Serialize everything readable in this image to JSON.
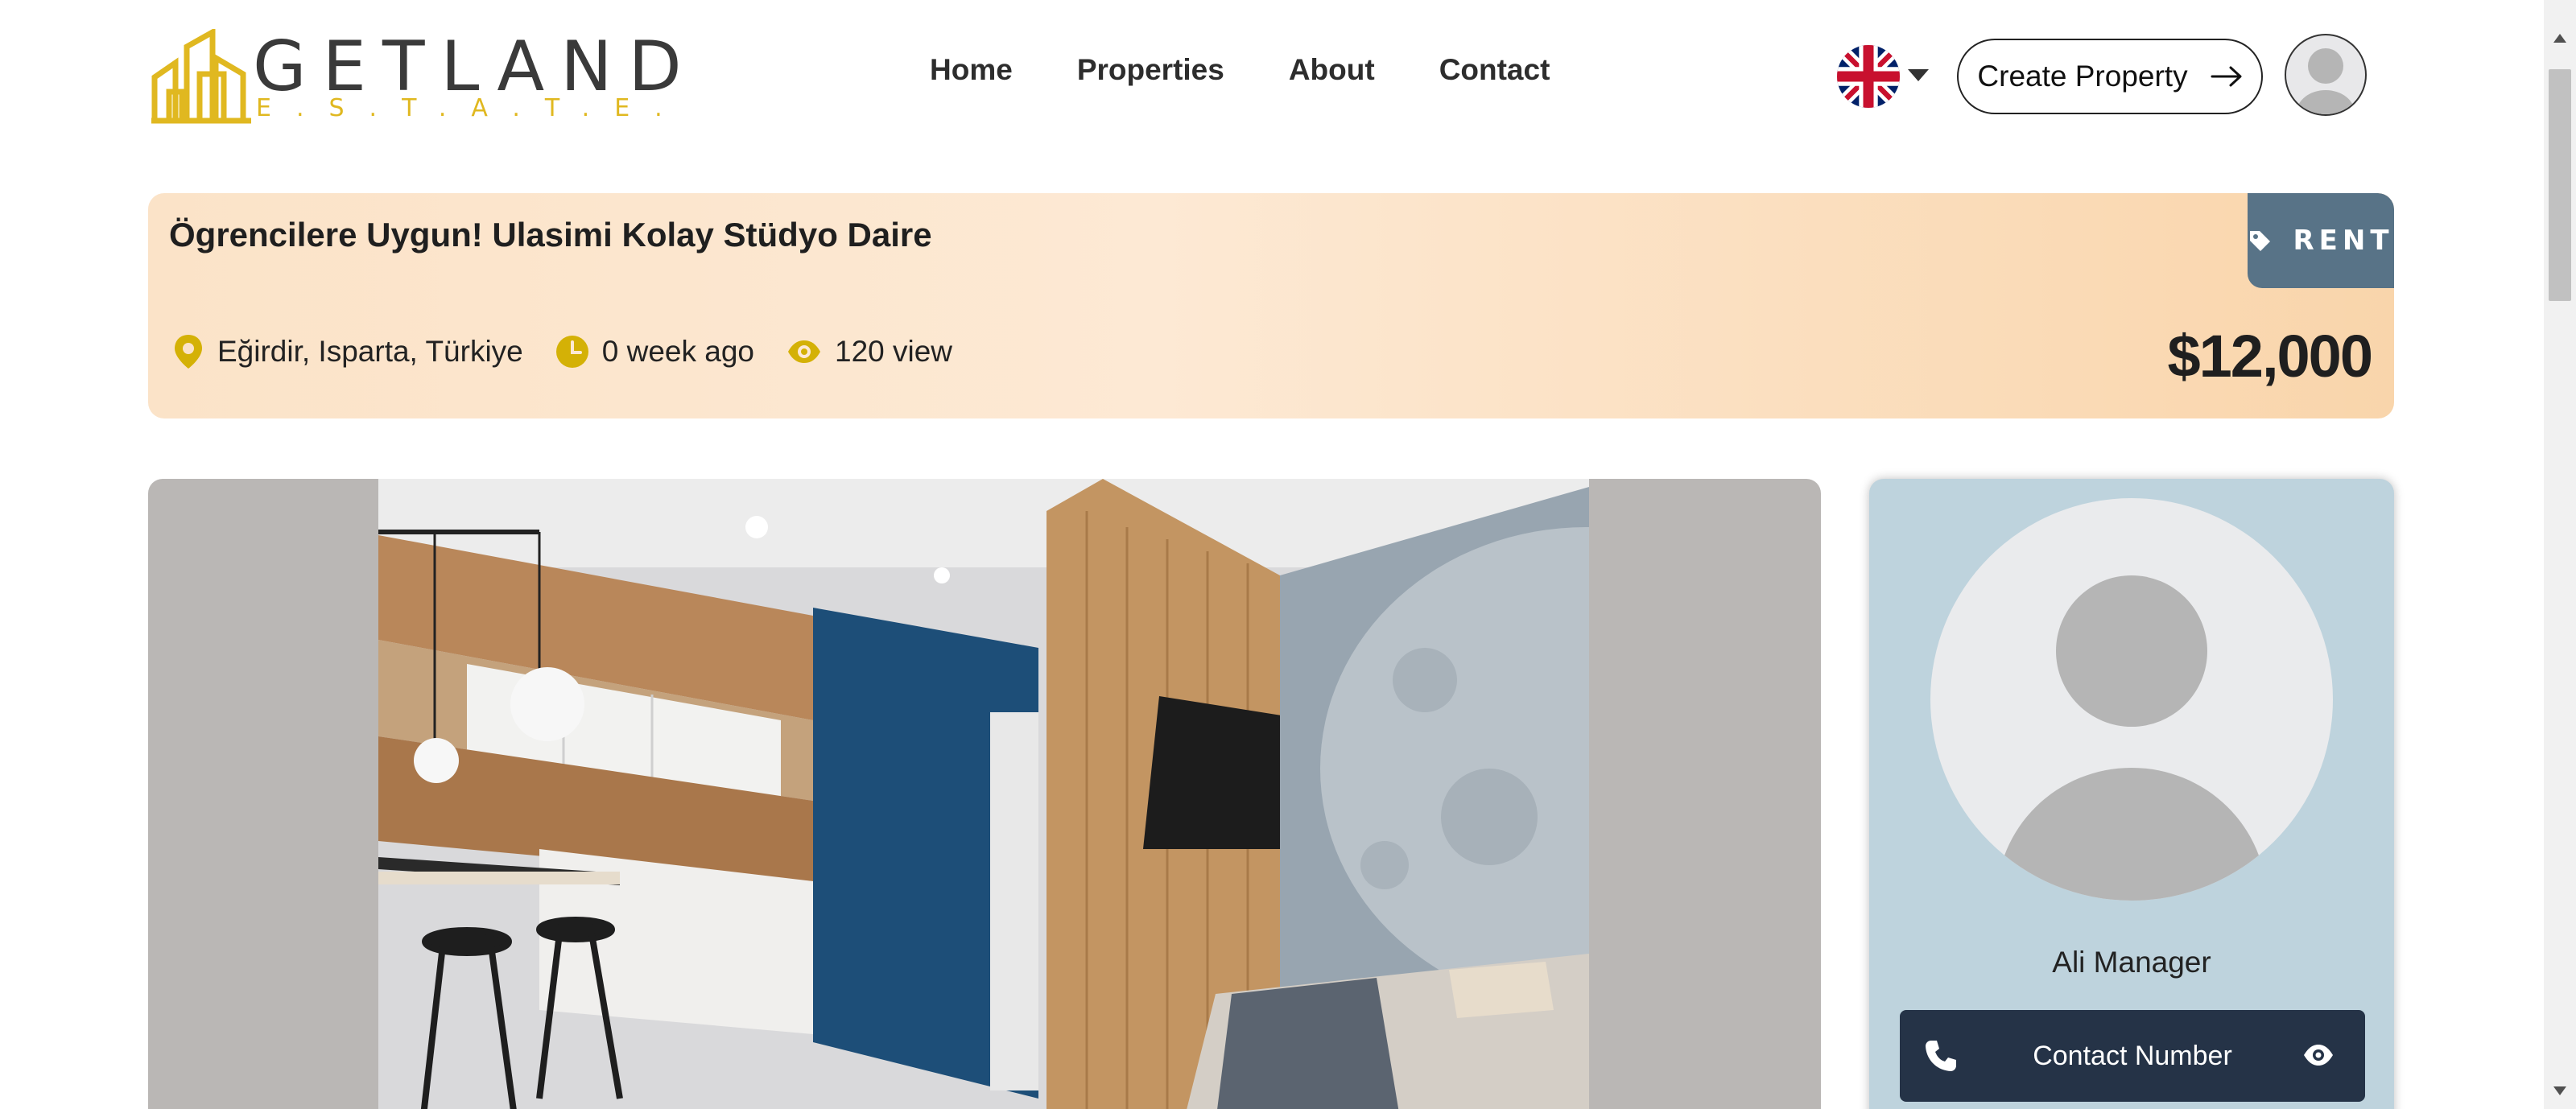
{
  "brand": {
    "name": "GETLAND",
    "sub": "E.S.T.A.T.E.",
    "logo_color": "#e0b820",
    "text_color": "#3a3a3a"
  },
  "nav": {
    "items": [
      {
        "label": "Home"
      },
      {
        "label": "Properties"
      },
      {
        "label": "About"
      },
      {
        "label": "Contact"
      }
    ]
  },
  "header": {
    "language_icon": "uk-flag-icon",
    "create_button_label": "Create Property",
    "create_button_icon": "arrow-right-icon",
    "avatar_icon": "user-avatar-icon"
  },
  "listing": {
    "title": "Ögrencilere Uygun! Ulasimi Kolay Stüdyo Daire",
    "tag_label": "RENT",
    "tag_icon": "tag-icon",
    "tag_color": "#587387",
    "location": "Eğirdir, Isparta, Türkiye",
    "location_icon": "map-pin-icon",
    "posted": "0 week ago",
    "posted_icon": "clock-icon",
    "views": "120 view",
    "views_icon": "eye-icon",
    "price": "$12,000",
    "accent_color": "#d4b106"
  },
  "agent": {
    "name": "Ali Manager",
    "contact_label": "Contact Number",
    "phone_icon": "phone-icon",
    "reveal_icon": "eye-icon",
    "button_color": "#253347",
    "card_color": "#bed3dd"
  }
}
